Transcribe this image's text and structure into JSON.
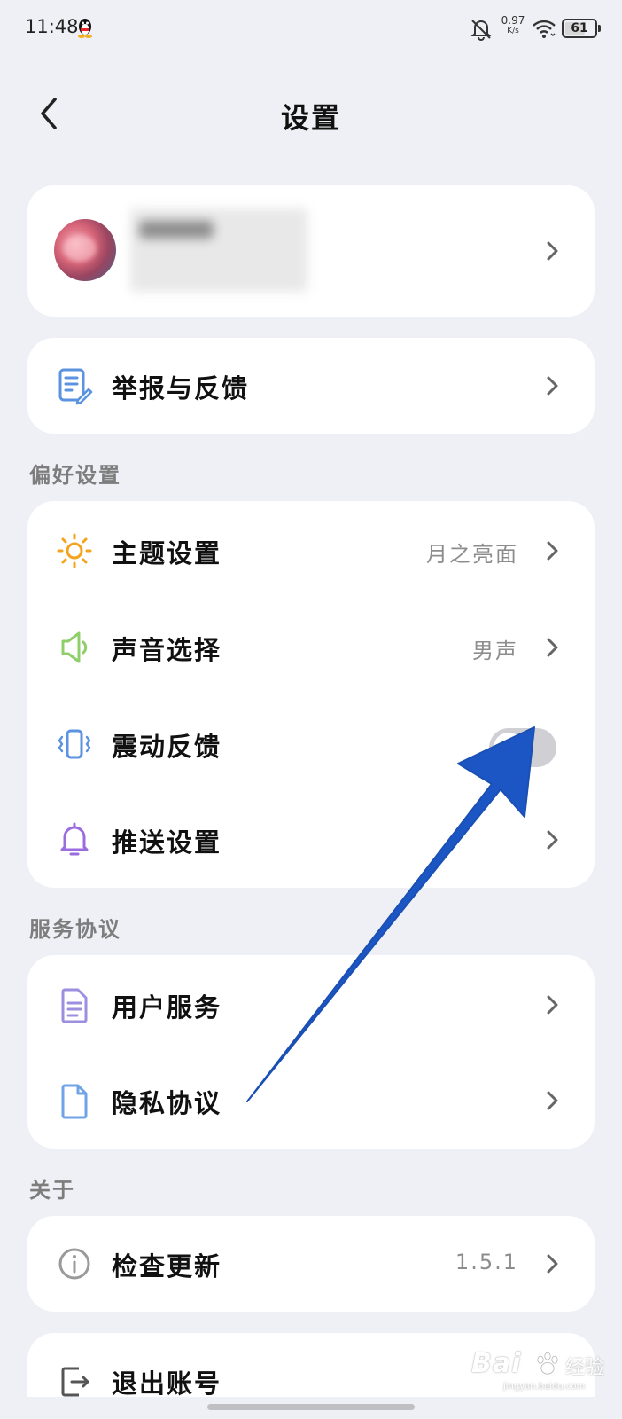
{
  "status_bar": {
    "time": "11:48",
    "net_speed_value": "0.97",
    "net_speed_unit": "K/s",
    "battery": "61"
  },
  "header": {
    "title": "设置"
  },
  "report_item": {
    "label": "举报与反馈",
    "icon": "document-edit-icon"
  },
  "sections": {
    "preferences": {
      "title": "偏好设置",
      "theme": {
        "label": "主题设置",
        "value": "月之亮面",
        "icon": "sun-icon"
      },
      "voice": {
        "label": "声音选择",
        "value": "男声",
        "icon": "speaker-icon"
      },
      "vibration": {
        "label": "震动反馈",
        "toggle_on": false,
        "icon": "vibrate-phone-icon"
      },
      "push": {
        "label": "推送设置",
        "icon": "bell-icon"
      }
    },
    "agreements": {
      "title": "服务协议",
      "user_service": {
        "label": "用户服务",
        "icon": "document-icon"
      },
      "privacy": {
        "label": "隐私协议",
        "icon": "file-icon"
      }
    },
    "about": {
      "title": "关于",
      "check_update": {
        "label": "检查更新",
        "value": "1.5.1",
        "icon": "info-icon"
      },
      "logout": {
        "label": "退出账号",
        "icon": "logout-icon"
      }
    }
  },
  "watermark": {
    "brand": "Bai",
    "brand_tail": "du",
    "cn": "经验",
    "url": "jingyan.baidu.com"
  },
  "colors": {
    "background": "#eff0f5",
    "card": "#ffffff",
    "arrow": "#1c56c4",
    "theme_icon": "#f4a31d",
    "voice_icon": "#8fcf6a",
    "vibrate_icon": "#5b93e0",
    "bell_icon": "#9b6be0"
  }
}
